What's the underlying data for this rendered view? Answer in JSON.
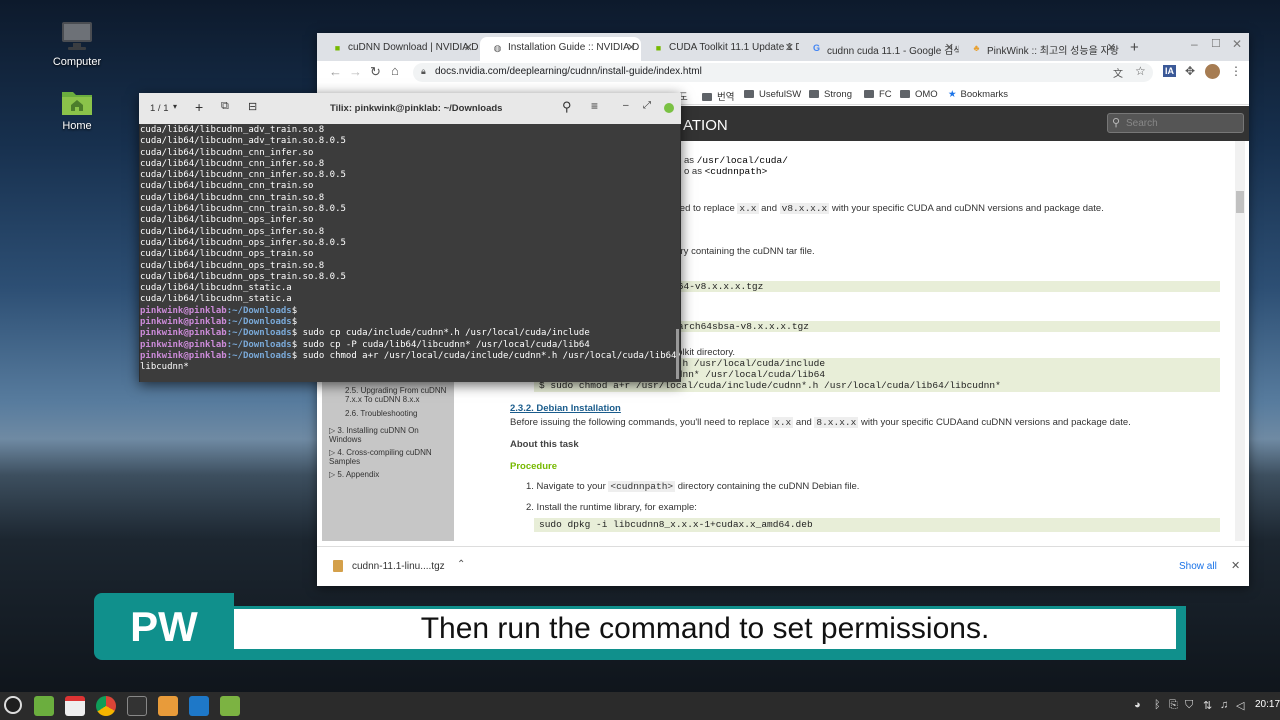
{
  "desktop": {
    "icons": [
      {
        "label": "Computer",
        "icon": "computer-icon"
      },
      {
        "label": "Home",
        "icon": "home-folder-icon"
      }
    ]
  },
  "browser": {
    "tabs": [
      {
        "title": "cuDNN Download | NVIDIA D",
        "active": false
      },
      {
        "title": "Installation Guide :: NVIDIA D",
        "active": true
      },
      {
        "title": "CUDA Toolkit 11.1 Update 1 D",
        "active": false
      },
      {
        "title": "cudnn cuda 11.1 - Google 검색",
        "active": false
      },
      {
        "title": "PinkWink :: 최고의 성능을 자랑",
        "active": false
      }
    ],
    "url": "docs.nvidia.com/deeplearning/cudnn/install-guide/index.html",
    "bookmarks": [
      {
        "label": "번역",
        "icon": "folder-icon"
      },
      {
        "label": "UsefulSW",
        "icon": "folder-icon"
      },
      {
        "label": "Strong",
        "icon": "folder-icon"
      },
      {
        "label": "FC",
        "icon": "folder-icon"
      },
      {
        "label": "OMO",
        "icon": "folder-icon"
      },
      {
        "label": "Bookmarks",
        "icon": "star-icon"
      }
    ],
    "bookmark_partial": "도",
    "page_title": "ATION",
    "search_placeholder": "Search",
    "sidebar_items": [
      "2.5. Upgrading From cuDNN 7.x.x To cuDNN 8.x.x",
      "2.6. Troubleshooting",
      "3. Installing cuDNN On Windows",
      "4. Cross-compiling cuDNN Samples",
      "5. Appendix"
    ],
    "content": {
      "frag_as": "as",
      "frag_as_path": "/usr/local/cuda/",
      "frag_o_as": "o as",
      "frag_cudnnpath": "<cudnnpath>",
      "replace_line_pre": "ou'll need to replace",
      "replace_xx": "x.x",
      "replace_and": "and",
      "replace_v8": "v8.x.x.x",
      "replace_post": "with your specific CUDA and cuDNN versions and package date.",
      "dir_line": "directory containing the cuDNN tar file.",
      "tgz1": "ux-x64-v8.x.x.x.tgz",
      "tgz2": "ux-aarch64sbsa-v8.x.x.x.tgz",
      "toolkit_dir": "DA Toolkit directory.",
      "cmd1": "dnn*.h /usr/local/cuda/include",
      "cmd2": "ibcudnn* /usr/local/cuda/lib64",
      "cmd3": "$ sudo chmod a+r /usr/local/cuda/include/cudnn*.h /usr/local/cuda/lib64/libcudnn*",
      "section_title": "2.3.2. Debian Installation",
      "deb_pre": "Before issuing the following commands, you'll need to replace",
      "deb_xx": "x.x",
      "deb_and": "and",
      "deb_8x": "8.x.x.x",
      "deb_post": "with your specific CUDAand cuDNN versions and package date.",
      "about": "About this task",
      "procedure": "Procedure",
      "step1_pre": "1. Navigate to your",
      "step1_code": "<cudnnpath>",
      "step1_post": "directory containing the cuDNN Debian file.",
      "step2": "2. Install the runtime library, for example:",
      "deb_cmd": "sudo dpkg -i libcudnn8_x.x.x-1+cudax.x_amd64.deb"
    },
    "download": {
      "file": "cudnn-11.1-linu....tgz",
      "show_all": "Show all"
    }
  },
  "terminal": {
    "tab_counter": "1 / 1",
    "title": "Tilix: pinkwink@pinklab: ~/Downloads",
    "output": [
      "cuda/lib64/libcudnn_adv_train.so.8",
      "cuda/lib64/libcudnn_adv_train.so.8.0.5",
      "cuda/lib64/libcudnn_cnn_infer.so",
      "cuda/lib64/libcudnn_cnn_infer.so.8",
      "cuda/lib64/libcudnn_cnn_infer.so.8.0.5",
      "cuda/lib64/libcudnn_cnn_train.so",
      "cuda/lib64/libcudnn_cnn_train.so.8",
      "cuda/lib64/libcudnn_cnn_train.so.8.0.5",
      "cuda/lib64/libcudnn_ops_infer.so",
      "cuda/lib64/libcudnn_ops_infer.so.8",
      "cuda/lib64/libcudnn_ops_infer.so.8.0.5",
      "cuda/lib64/libcudnn_ops_train.so",
      "cuda/lib64/libcudnn_ops_train.so.8",
      "cuda/lib64/libcudnn_ops_train.so.8.0.5",
      "cuda/lib64/libcudnn_static.a",
      "cuda/lib64/libcudnn_static.a"
    ],
    "prompt_user": "pinkwink@pinklab",
    "prompt_path": ":~/Downloads",
    "commands": [
      "",
      "",
      " sudo cp cuda/include/cudnn*.h /usr/local/cuda/include",
      " sudo cp -P cuda/lib64/libcudnn* /usr/local/cuda/lib64",
      " sudo chmod a+r /usr/local/cuda/include/cudnn*.h /usr/local/cuda/lib64/"
    ],
    "wrap_line": "libcudnn*"
  },
  "subtitle": {
    "badge": "PW",
    "text": "Then run the command to set permissions."
  },
  "taskbar": {
    "clock": "20:17"
  }
}
